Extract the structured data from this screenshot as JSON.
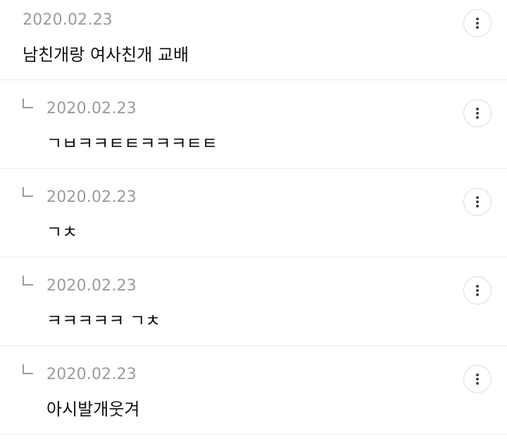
{
  "comments": [
    {
      "date": "2020.02.23",
      "text": "남친개랑 여사친개 교배",
      "menu_icon": "more-vertical-icon"
    },
    {
      "date": "2020.02.23",
      "text": "ㄱㅂㅋㅋㅌㅌㅋㅋㅋㅌㅌ",
      "menu_icon": "more-vertical-icon"
    },
    {
      "date": "2020.02.23",
      "text": "ㄱㅊ",
      "menu_icon": "more-vertical-icon"
    },
    {
      "date": "2020.02.23",
      "text": "ㅋㅋㅋㅋㅋ ㄱㅊ",
      "menu_icon": "more-vertical-icon"
    },
    {
      "date": "2020.02.23",
      "text": "아시발개웃겨",
      "menu_icon": "more-vertical-icon"
    }
  ]
}
